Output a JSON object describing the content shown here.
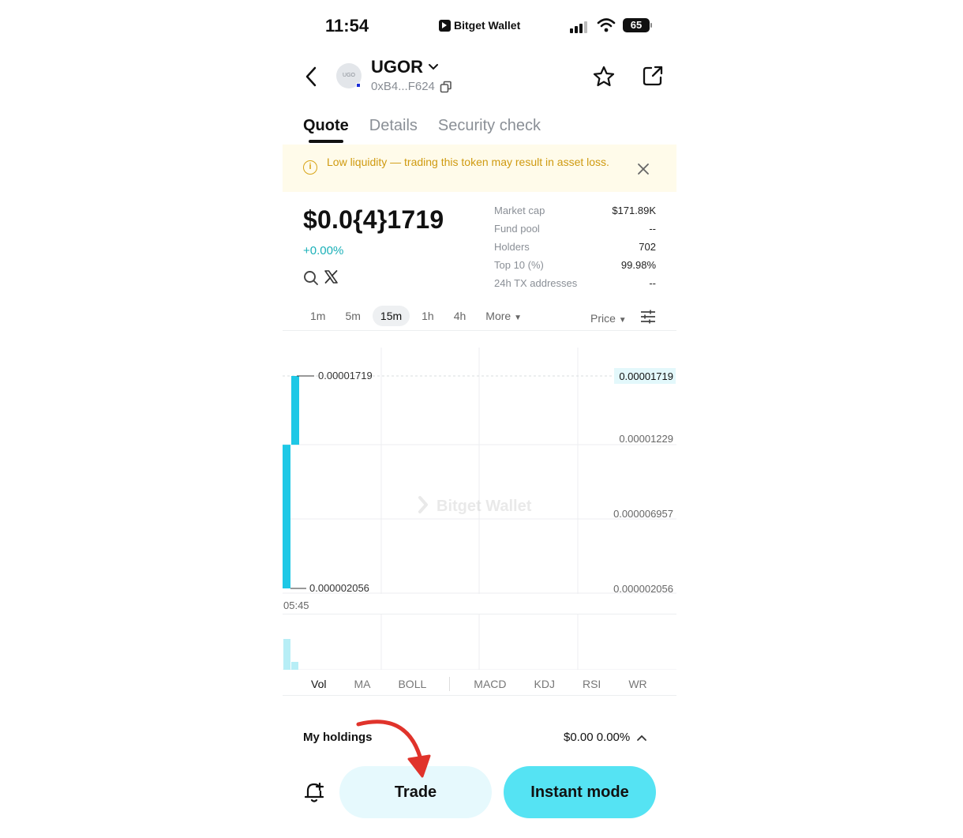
{
  "status_bar": {
    "time": "11:54",
    "carrier": "Bitget Wallet",
    "battery": "65"
  },
  "header": {
    "token_symbol": "UGOR",
    "avatar_text": "UGO",
    "address": "0xB4...F624"
  },
  "tabs": [
    "Quote",
    "Details",
    "Security check"
  ],
  "warning": {
    "text": "Low liquidity — trading this token may result in asset loss."
  },
  "quote": {
    "price": "$0.0{4}1719",
    "change": "+0.00%"
  },
  "stats": [
    {
      "label": "Market cap",
      "value": "$171.89K"
    },
    {
      "label": "Fund pool",
      "value": "--"
    },
    {
      "label": "Holders",
      "value": "702"
    },
    {
      "label": "Top 10 (%)",
      "value": "99.98%"
    },
    {
      "label": "24h TX addresses",
      "value": "--"
    }
  ],
  "timeframes": [
    "1m",
    "5m",
    "15m",
    "1h",
    "4h"
  ],
  "timeframe_selected": "15m",
  "more_label": "More",
  "price_mode_label": "Price",
  "chart": {
    "high_label": "0.00001719",
    "low_label": "0.000002056",
    "y_axis": [
      "0.00001719",
      "0.00001229",
      "0.000006957",
      "0.000002056"
    ],
    "time_label": "05:45",
    "watermark": "Bitget Wallet",
    "accent": "#1ec8e6"
  },
  "chart_data": {
    "type": "candlestick",
    "x": [
      "05:45"
    ],
    "ylim": [
      2.056e-06,
      1.719e-05
    ],
    "candles": [
      {
        "low": 2.056e-06,
        "high": 1.229e-05
      },
      {
        "low": 1.229e-05,
        "high": 1.719e-05
      }
    ]
  },
  "indicators": [
    "Vol",
    "MA",
    "BOLL",
    "MACD",
    "KDJ",
    "RSI",
    "WR"
  ],
  "indicator_selected": "Vol",
  "holdings": {
    "label": "My holdings",
    "value": "$0.00 0.00%"
  },
  "buttons": {
    "trade": "Trade",
    "instant": "Instant mode"
  },
  "colors": {
    "instant_bg": "#55e3f3",
    "trade_bg": "#e6f9fd",
    "warning_text": "#cf9a10",
    "positive": "#1ab0b8",
    "arrow": "#e0332b"
  }
}
